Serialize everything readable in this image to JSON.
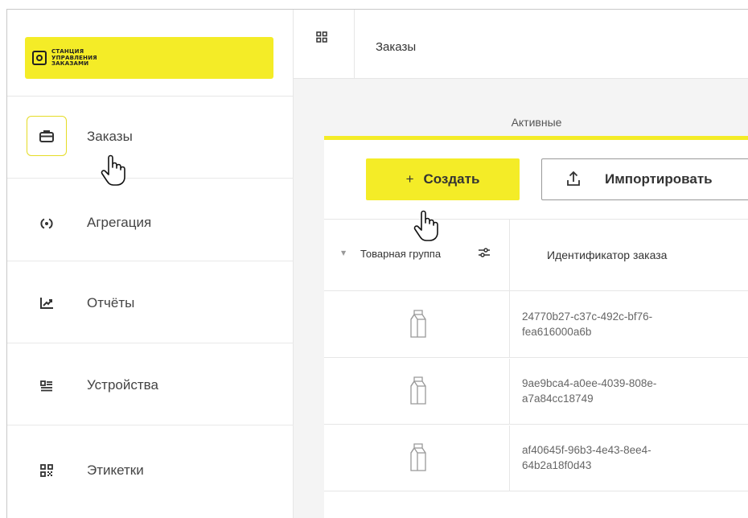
{
  "logo": {
    "line1": "СТАНЦИЯ",
    "line2": "УПРАВЛЕНИЯ",
    "line3": "ЗАКАЗАМИ"
  },
  "sidebar": {
    "items": [
      {
        "label": "Заказы",
        "icon": "briefcase-icon",
        "active": true
      },
      {
        "label": "Агрегация",
        "icon": "aggregation-icon"
      },
      {
        "label": "Отчёты",
        "icon": "chart-icon"
      },
      {
        "label": "Устройства",
        "icon": "devices-icon"
      },
      {
        "label": "Этикетки",
        "icon": "qr-icon"
      }
    ]
  },
  "header": {
    "title": "Заказы",
    "grid_icon": "grid-icon"
  },
  "tabs": {
    "active_label": "Активные"
  },
  "toolbar": {
    "create_plus": "+",
    "create_label": "Создать",
    "import_label": "Импортировать"
  },
  "table": {
    "columns": [
      "Товарная группа",
      "Идентификатор заказа"
    ],
    "rows": [
      {
        "group_icon": "milk-carton-icon",
        "id_line1": "24770b27-c37c-492c-bf76-",
        "id_line2": "fea616000a6b"
      },
      {
        "group_icon": "milk-carton-icon",
        "id_line1": "9ae9bca4-a0ee-4039-808e-",
        "id_line2": "a7a84cc18749"
      },
      {
        "group_icon": "milk-carton-icon",
        "id_line1": "af40645f-96b3-4e43-8ee4-",
        "id_line2": "64b2a18f0d43"
      }
    ]
  },
  "colors": {
    "accent": "#f4ec27",
    "active_border": "#e5dc25",
    "content_bg": "#f4f4f4"
  }
}
